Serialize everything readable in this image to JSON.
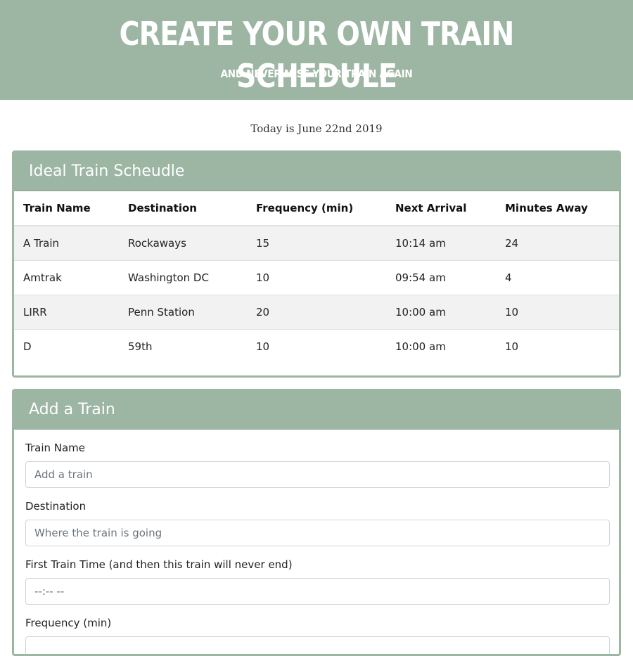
{
  "header": {
    "title": "CREATE YOUR OWN TRAIN SCHEDULE",
    "subtitle": "AND NEVER MISS YOUR TRAIN AGAIN"
  },
  "today_text": "Today is June 22nd 2019",
  "schedule": {
    "title": "Ideal Train Scheudle",
    "columns": [
      "Train Name",
      "Destination",
      "Frequency (min)",
      "Next Arrival",
      "Minutes Away"
    ],
    "rows": [
      [
        "A Train",
        "Rockaways",
        "15",
        "10:14 am",
        "24"
      ],
      [
        "Amtrak",
        "Washington DC",
        "10",
        "09:54 am",
        "4"
      ],
      [
        "LIRR",
        "Penn Station",
        "20",
        "10:00 am",
        "10"
      ],
      [
        "D",
        "59th",
        "10",
        "10:00 am",
        "10"
      ]
    ]
  },
  "add_train": {
    "title": "Add a Train",
    "fields": [
      {
        "label": "Train Name",
        "placeholder": "Add a train",
        "value": ""
      },
      {
        "label": "Destination",
        "placeholder": "Where the train is going",
        "value": ""
      },
      {
        "label": "First Train Time (and then this train will never end)",
        "placeholder": "--:-- --",
        "value": ""
      },
      {
        "label": "Frequency (min)",
        "placeholder": "",
        "value": ""
      }
    ]
  },
  "colors": {
    "accent": "#9db5a3",
    "stripe": "#f2f2f2"
  }
}
